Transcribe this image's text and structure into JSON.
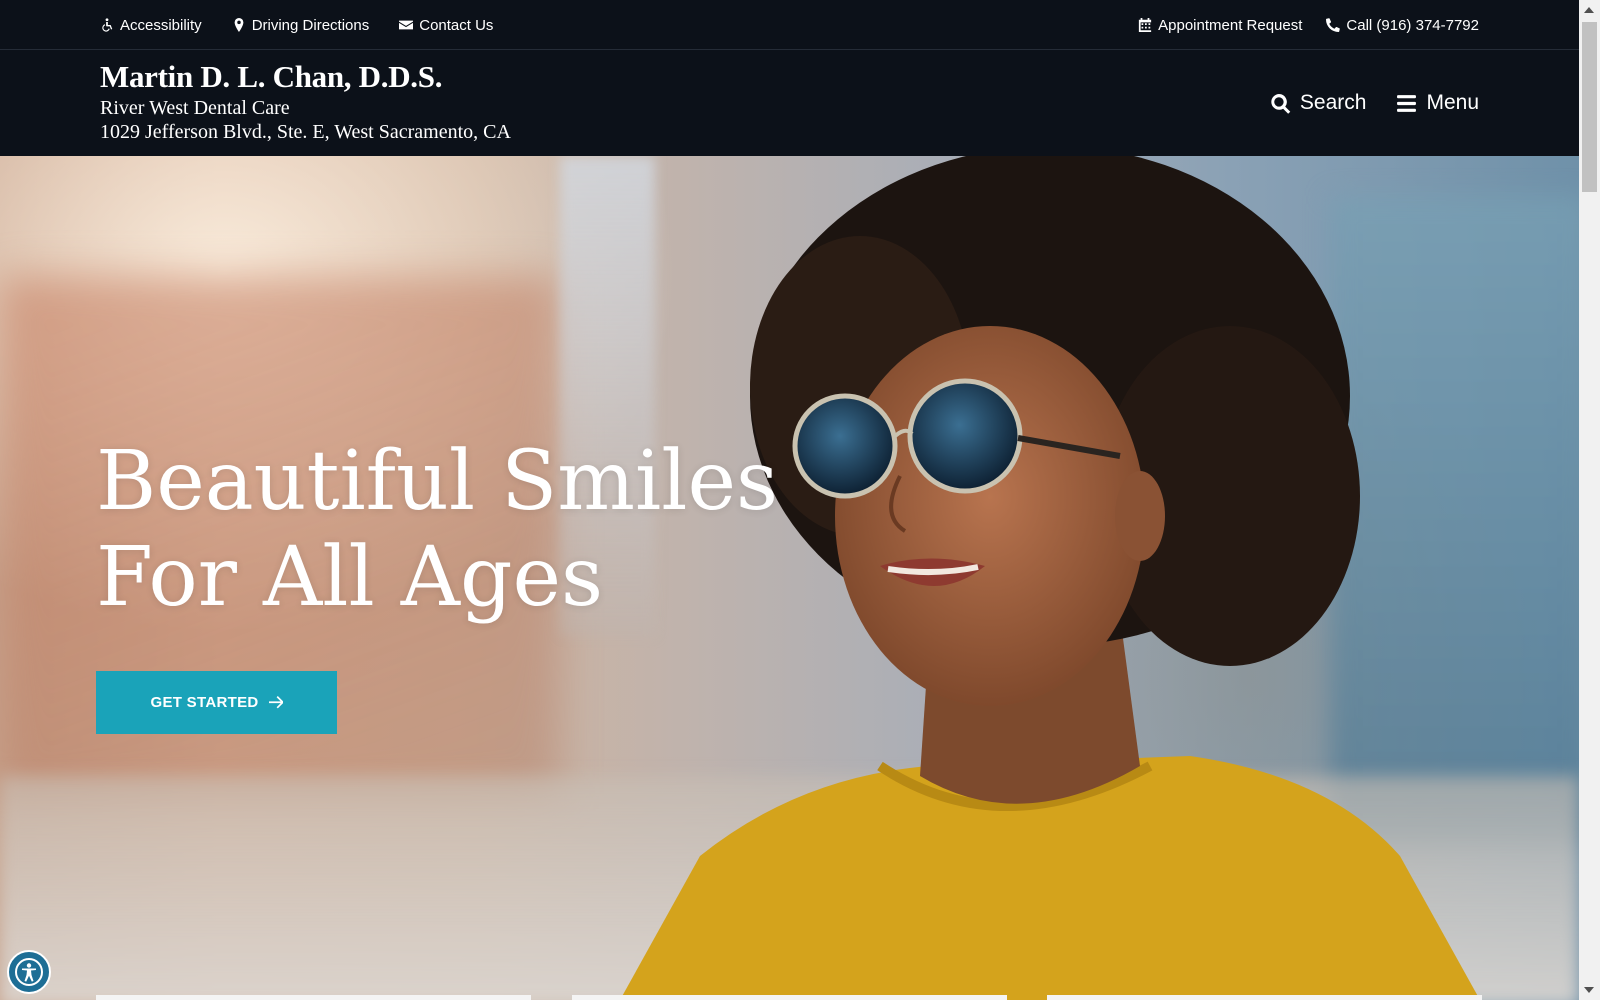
{
  "topbar": {
    "left_links": [
      {
        "label": "Accessibility",
        "icon": "wheelchair-icon"
      },
      {
        "label": "Driving Directions",
        "icon": "map-marker-icon"
      },
      {
        "label": "Contact Us",
        "icon": "envelope-icon"
      }
    ],
    "right_links": [
      {
        "label": "Appointment Request",
        "icon": "calendar-icon"
      },
      {
        "label": "Call (916) 374-7792",
        "icon": "phone-icon"
      }
    ]
  },
  "header": {
    "name": "Martin D. L. Chan, D.D.S.",
    "practice": "River West Dental Care",
    "address": "1029 Jefferson Blvd., Ste. E, West Sacramento, CA",
    "search_label": "Search",
    "menu_label": "Menu"
  },
  "hero": {
    "title_line1": "Beautiful Smiles",
    "title_line2": "For All Ages",
    "cta_label": "GET STARTED"
  },
  "colors": {
    "header_bg": "#0c1119",
    "accent": "#1aa3b9",
    "a11y_button": "#1e6e95"
  }
}
